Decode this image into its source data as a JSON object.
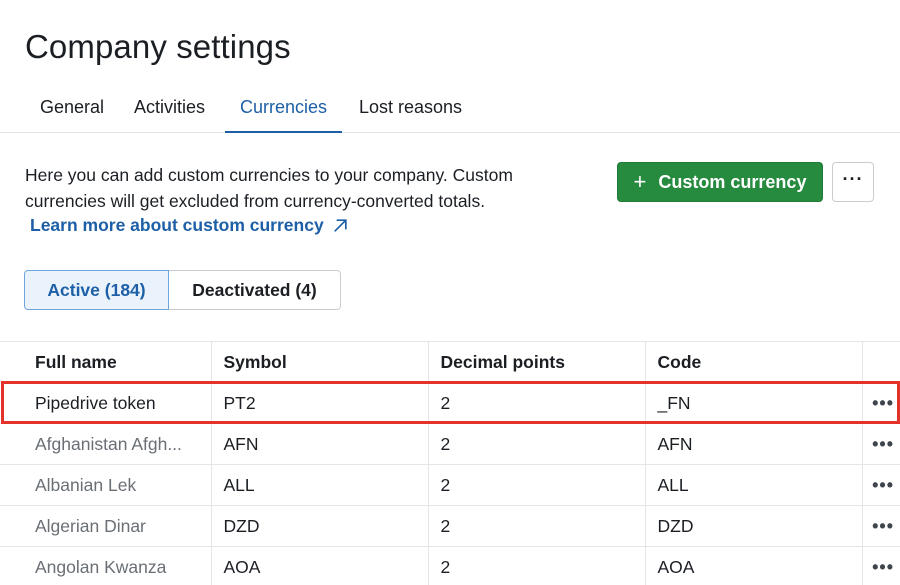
{
  "page": {
    "title": "Company settings"
  },
  "tabs": [
    {
      "label": "General",
      "active": false
    },
    {
      "label": "Activities",
      "active": false
    },
    {
      "label": "Currencies",
      "active": true
    },
    {
      "label": "Lost reasons",
      "active": false
    }
  ],
  "intro": {
    "description": "Here you can add custom currencies to your company. Custom currencies will get excluded from currency-converted totals.",
    "learn_more_label": "Learn more about custom currency",
    "learn_more_icon": "external-arrow-icon"
  },
  "actions": {
    "add_label": "Custom currency",
    "add_icon": "plus-icon",
    "more_icon": "more-horizontal-icon",
    "more_label": "···"
  },
  "filters": [
    {
      "label": "Active (184)",
      "active": true
    },
    {
      "label": "Deactivated (4)",
      "active": false
    }
  ],
  "table": {
    "columns": [
      "Full name",
      "Symbol",
      "Decimal points",
      "Code"
    ],
    "row_menu_label": "•••",
    "rows": [
      {
        "name": "Pipedrive token",
        "symbol": "PT2",
        "decimals": "2",
        "code": "_FN",
        "highlighted": true
      },
      {
        "name": "Afghanistan Afgh...",
        "symbol": "AFN",
        "decimals": "2",
        "code": "AFN",
        "highlighted": false
      },
      {
        "name": "Albanian Lek",
        "symbol": "ALL",
        "decimals": "2",
        "code": "ALL",
        "highlighted": false
      },
      {
        "name": "Algerian Dinar",
        "symbol": "DZD",
        "decimals": "2",
        "code": "DZD",
        "highlighted": false
      },
      {
        "name": "Angolan Kwanza",
        "symbol": "AOA",
        "decimals": "2",
        "code": "AOA",
        "highlighted": false
      }
    ]
  },
  "colors": {
    "accent": "#1d5fa6",
    "primary_button": "#268a3f",
    "highlight_outline": "#e2322a"
  }
}
